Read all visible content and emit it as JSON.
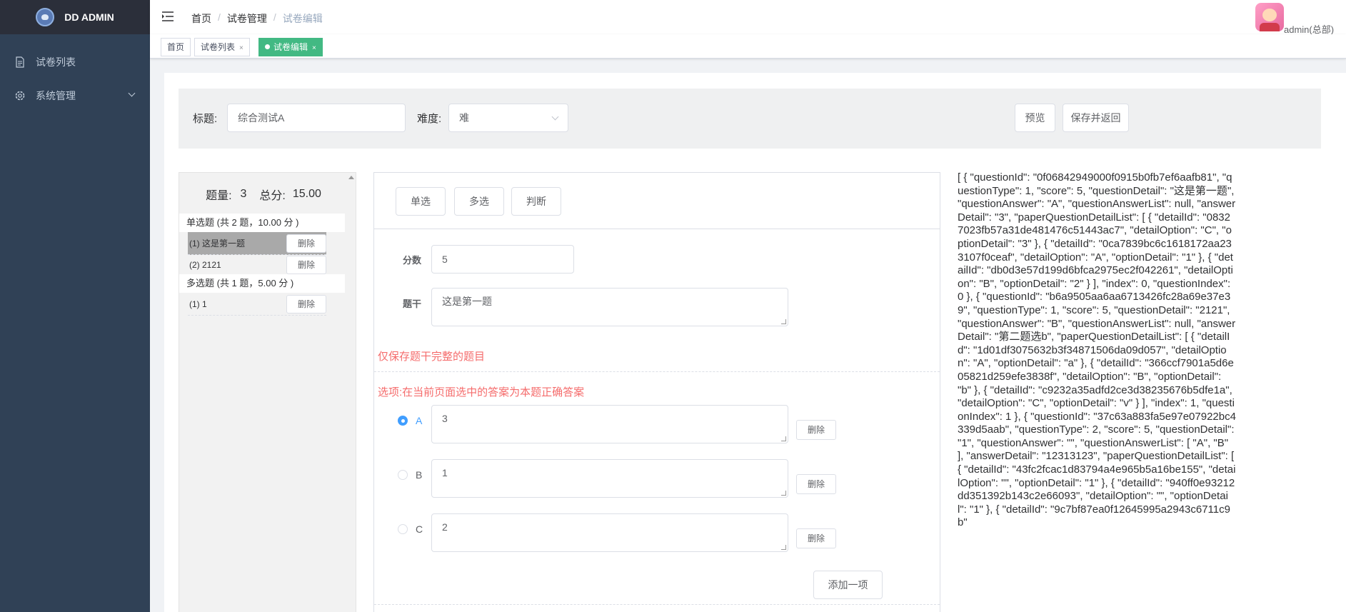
{
  "sidebar": {
    "logo_text": "DD ADMIN",
    "items": [
      {
        "label": "试卷列表"
      },
      {
        "label": "系统管理"
      }
    ]
  },
  "navbar": {
    "breadcrumb": [
      "首页",
      "试卷管理",
      "试卷编辑"
    ],
    "user": "admin(总部)"
  },
  "tags": [
    {
      "label": "首页"
    },
    {
      "label": "试卷列表",
      "close": "×"
    },
    {
      "label": "试卷编辑",
      "close": "×"
    }
  ],
  "form": {
    "title_label": "标题:",
    "title_value": "综合测试A",
    "difficulty_label": "难度:",
    "difficulty_value": "难",
    "preview_label": "预览",
    "save_label": "保存并返回"
  },
  "summary": {
    "count_label": "题量:",
    "count_value": "3",
    "total_label": "总分:",
    "total_value": "15.00"
  },
  "question_groups": [
    {
      "title": "单选题 (共 2 题，10.00 分 )",
      "items": [
        {
          "label": "(1) 这是第一题"
        },
        {
          "label": "(2) 2121"
        }
      ]
    },
    {
      "title": "多选题 (共 1 题，5.00 分 )",
      "items": [
        {
          "label": "(1) 1"
        }
      ]
    }
  ],
  "delete_label": "删除",
  "editor": {
    "types": [
      "单选",
      "多选",
      "判断"
    ],
    "score_label": "分数",
    "score_value": "5",
    "stem_label": "题干",
    "stem_value": "这是第一题",
    "warning": "仅保存题干完整的题目",
    "options_hint": "选项:在当前页面选中的答案为本题正确答案",
    "options": [
      {
        "letter": "A",
        "value": "3"
      },
      {
        "letter": "B",
        "value": "1"
      },
      {
        "letter": "C",
        "value": "2"
      }
    ],
    "add_label": "添加一项"
  },
  "json_text": "[ { \"questionId\": \"0f06842949000f0915b0fb7ef6aafb81\", \"questionType\": 1, \"score\": 5, \"questionDetail\": \"这是第一题\", \"questionAnswer\": \"A\", \"questionAnswerList\": null, \"answerDetail\": \"3\", \"paperQuestionDetailList\": [ { \"detailId\": \"08327023fb57a31de481476c51443ac7\", \"detailOption\": \"C\", \"optionDetail\": \"3\" }, { \"detailId\": \"0ca7839bc6c1618172aa233107f0ceaf\", \"detailOption\": \"A\", \"optionDetail\": \"1\" }, { \"detailId\": \"db0d3e57d199d6bfca2975ec2f042261\", \"detailOption\": \"B\", \"optionDetail\": \"2\" } ], \"index\": 0, \"questionIndex\": 0 }, { \"questionId\": \"b6a9505aa6aa6713426fc28a69e37e39\", \"questionType\": 1, \"score\": 5, \"questionDetail\": \"2121\", \"questionAnswer\": \"B\", \"questionAnswerList\": null, \"answerDetail\": \"第二题选b\", \"paperQuestionDetailList\": [ { \"detailId\": \"1d01df3075632b3f34871506da09d057\", \"detailOption\": \"A\", \"optionDetail\": \"a\" }, { \"detailId\": \"366ccf7901a5d6e05821d259efe3838f\", \"detailOption\": \"B\", \"optionDetail\": \"b\" }, { \"detailId\": \"c9232a35adfd2ce3d38235676b5dfe1a\", \"detailOption\": \"C\", \"optionDetail\": \"v\" } ], \"index\": 1, \"questionIndex\": 1 }, { \"questionId\": \"37c63a883fa5e97e07922bc4339d5aab\", \"questionType\": 2, \"score\": 5, \"questionDetail\": \"1\", \"questionAnswer\": \"\", \"questionAnswerList\": [ \"A\", \"B\" ], \"answerDetail\": \"12313123\", \"paperQuestionDetailList\": [ { \"detailId\": \"43fc2fcac1d83794a4e965b5a16be155\", \"detailOption\": \"\", \"optionDetail\": \"1\" }, { \"detailId\": \"940ff0e93212dd351392b143c2e66093\", \"detailOption\": \"\", \"optionDetail\": \"1\" }, { \"detailId\": \"9c7bf87ea0f12645995a2943c6711c9b\""
}
